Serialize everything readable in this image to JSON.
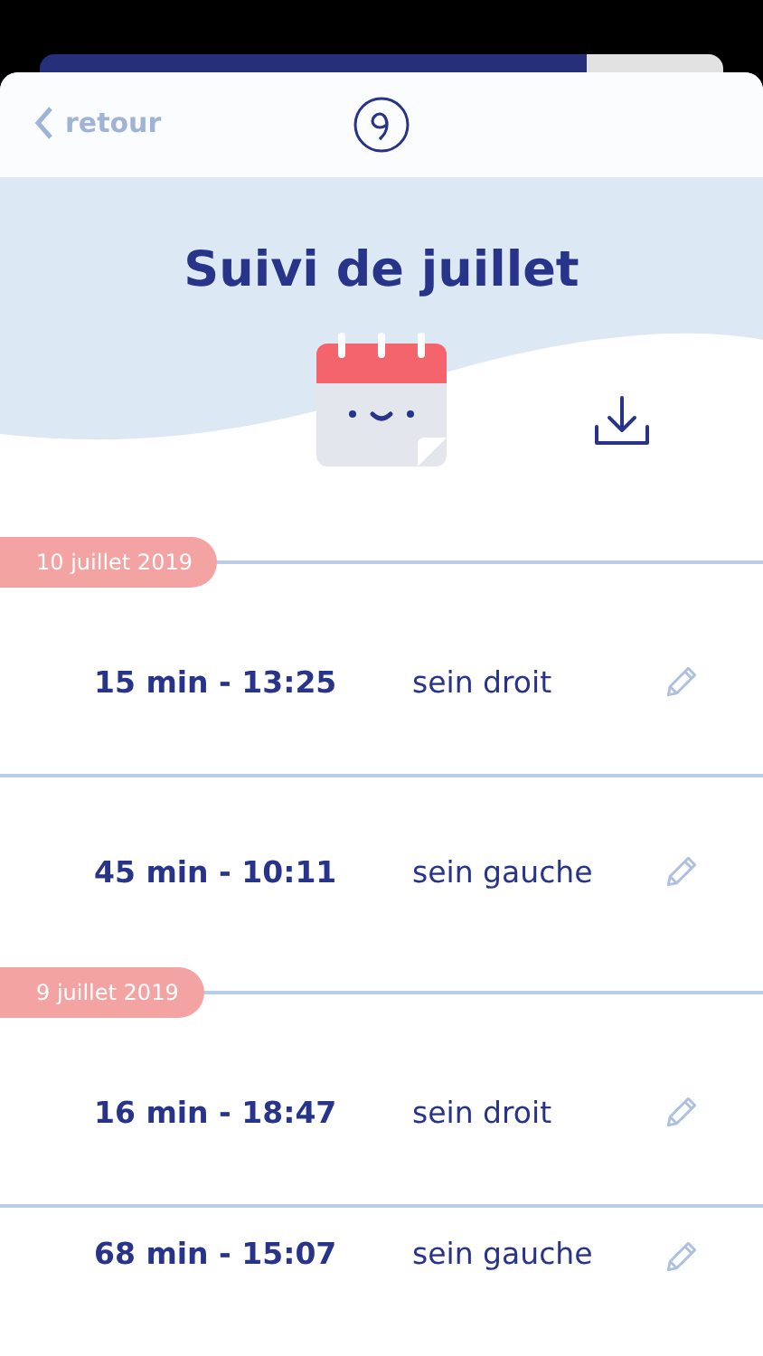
{
  "header": {
    "back_label": "retour"
  },
  "hero": {
    "title": "Suivi de juillet"
  },
  "groups": [
    {
      "date": "10 juillet 2019",
      "entries": [
        {
          "time": "15 min - 13:25",
          "side": "sein droit"
        },
        {
          "time": "45 min - 10:11",
          "side": "sein gauche"
        }
      ]
    },
    {
      "date": "9 juillet 2019",
      "entries": [
        {
          "time": "16 min - 18:47",
          "side": "sein droit"
        },
        {
          "time": "68 min - 15:07",
          "side": "sein gauche"
        }
      ]
    }
  ]
}
